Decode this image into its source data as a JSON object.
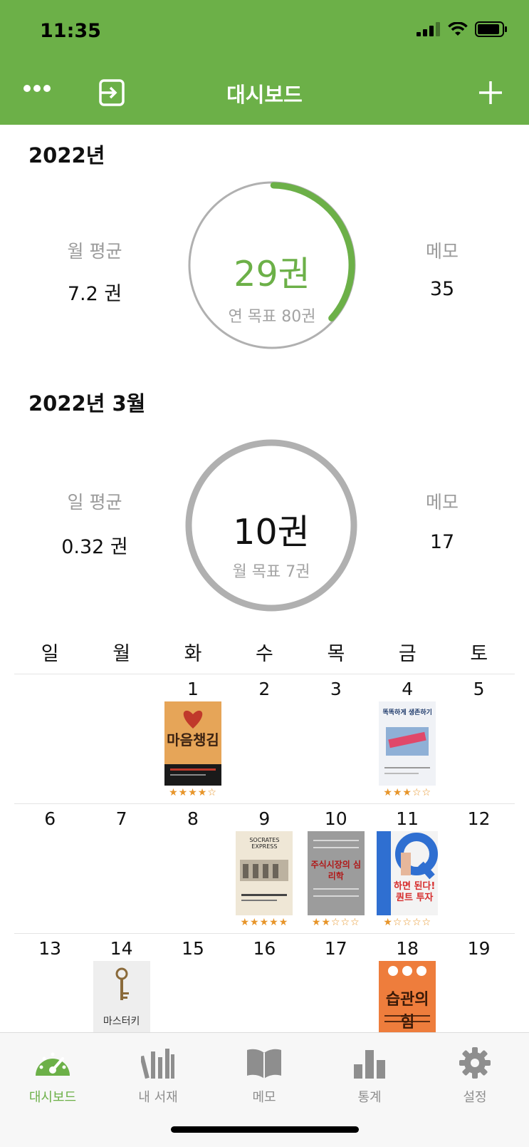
{
  "status_bar": {
    "time": "11:35"
  },
  "nav": {
    "title": "대시보드"
  },
  "year_section": {
    "title": "2022년",
    "left_label": "월 평균",
    "left_value": "7.2 권",
    "right_label": "메모",
    "right_value": "35",
    "center_value": "29권",
    "center_sub": "연 목표 80권",
    "progress": 0.3625
  },
  "month_section": {
    "title": "2022년 3월",
    "left_label": "일 평균",
    "left_value": "0.32 권",
    "right_label": "메모",
    "right_value": "17",
    "center_value": "10권",
    "center_sub": "월 목표 7권",
    "progress": 1.0
  },
  "calendar": {
    "weekdays": [
      "일",
      "월",
      "화",
      "수",
      "목",
      "금",
      "토"
    ],
    "weeks": [
      [
        {
          "day": ""
        },
        {
          "day": ""
        },
        {
          "day": "1",
          "book": {
            "title": "마음챙김",
            "stars": "★★★★☆"
          }
        },
        {
          "day": "2"
        },
        {
          "day": "3"
        },
        {
          "day": "4",
          "book": {
            "title": "똑똑하게 생존하기",
            "stars": "★★★☆☆"
          }
        },
        {
          "day": "5"
        }
      ],
      [
        {
          "day": "6"
        },
        {
          "day": "7"
        },
        {
          "day": "8"
        },
        {
          "day": "9",
          "book": {
            "title": "SOCRATES EXPRESS",
            "stars": "★★★★★"
          }
        },
        {
          "day": "10",
          "book": {
            "title": "주식시장의 심리학",
            "stars": "★★☆☆☆"
          }
        },
        {
          "day": "11",
          "book": {
            "title": "하면 된다! 퀀트 투자",
            "stars": "★☆☆☆☆"
          }
        },
        {
          "day": "12"
        }
      ],
      [
        {
          "day": "13"
        },
        {
          "day": "14",
          "book": {
            "title": "마스터키"
          }
        },
        {
          "day": "15"
        },
        {
          "day": "16"
        },
        {
          "day": "17"
        },
        {
          "day": "18",
          "book": {
            "title": "습관의 힘"
          }
        },
        {
          "day": "19"
        }
      ]
    ]
  },
  "tabs": [
    {
      "label": "대시보드",
      "icon": "speedometer-icon",
      "active": true
    },
    {
      "label": "내 서재",
      "icon": "bookshelf-icon",
      "active": false
    },
    {
      "label": "메모",
      "icon": "open-book-icon",
      "active": false
    },
    {
      "label": "통계",
      "icon": "bar-chart-icon",
      "active": false
    },
    {
      "label": "설정",
      "icon": "gear-icon",
      "active": false
    }
  ],
  "colors": {
    "brand": "#6cb048",
    "ring_track": "#b0b0b0",
    "star": "#e7952a"
  }
}
